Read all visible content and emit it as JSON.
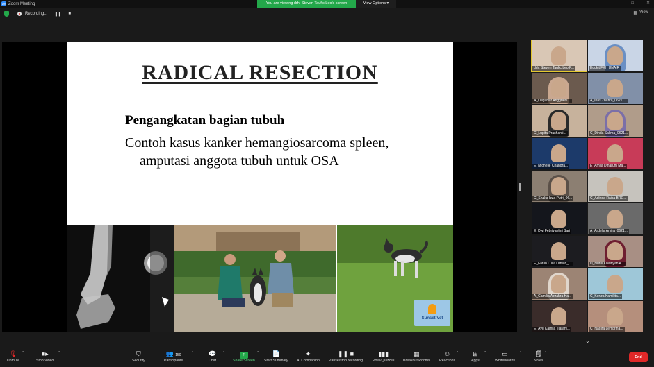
{
  "window": {
    "title": "Zoom Meeting",
    "app_icon": "zm"
  },
  "banner": {
    "viewing": "You are viewing drh. Steven Taufic Leo's screen",
    "view_options": "View Options"
  },
  "window_controls": {
    "minimize": "–",
    "maximize": "□",
    "close": "✕"
  },
  "status": {
    "recording_label": "Recording...",
    "pause": "❚❚",
    "stop": "■",
    "view": "View"
  },
  "slide": {
    "title": "RADICAL RESECTION",
    "subtitle": "Pengangkatan bagian tubuh",
    "line1": "Contoh kasus kanker hemangiosarcoma spleen,",
    "line2": "amputasi anggota tubuh untuk OSA",
    "logo_text": "Sunset Vet"
  },
  "participants": [
    {
      "name": "drh. Steven Taufic Leo P...",
      "color": "#d9c7b5",
      "active": true
    },
    {
      "name": "Edukit FKH UNAIR",
      "color": "#c9d5e6",
      "hijab": "#6a8fc4"
    },
    {
      "name": "A_Luigi Nur Anggraini...",
      "color": "#6b5a4e",
      "hijab": "#caa890"
    },
    {
      "name": "A_Inas Zhafira_06211...",
      "color": "#8190a8"
    },
    {
      "name": "C_Lupita Prashanti...",
      "color": "#c7b29c",
      "hijab": "#2a2a2a"
    },
    {
      "name": "C_Dinda Salima_0621...",
      "color": "#b09c8a",
      "hijab": "#7b6fa8"
    },
    {
      "name": "E_Michelle Chandra...",
      "color": "#1c3a6a"
    },
    {
      "name": "E_Amila Dinarum Ma...",
      "color": "#c83b58"
    },
    {
      "name": "C_Shaka Izza Putri_06...",
      "color": "#8c7f72",
      "hijab": "#5b5048"
    },
    {
      "name": "C_Adinda Raisa BRG...",
      "color": "#c6c3bd"
    },
    {
      "name": "E_Dwi Febriyantini Sari",
      "color": "#14161c"
    },
    {
      "name": "A_Ardelia Amira_0621...",
      "color": "#6a6a6a"
    },
    {
      "name": "E_Fatun Lulia Lutfiah_...",
      "color": "#1c1c20"
    },
    {
      "name": "D_Nurul Khairiyah A...",
      "color": "#a88f84",
      "hijab": "#6e1e30"
    },
    {
      "name": "A_Camilia Azzahra Ha...",
      "color": "#9c8474",
      "hijab": "#e0d6cc"
    },
    {
      "name": "C_Kenza Kamilita...",
      "color": "#9ec7d8"
    },
    {
      "name": "E_Ayu Kamila Tiarani...",
      "color": "#3a2c2a"
    },
    {
      "name": "C_Nadira Lembrina...",
      "color": "#b58f7c"
    }
  ],
  "toolbar": {
    "unmute": "Unmute",
    "stop_video": "Stop Video",
    "security": "Security",
    "participants": "Participants",
    "participant_count": "150",
    "chat": "Chat",
    "share_screen": "Share Screen",
    "start_summary": "Start Summary",
    "ai_companion": "AI Companion",
    "pause_recording": "Pause/stop recording",
    "polls": "Polls/Quizzes",
    "breakout": "Breakout Rooms",
    "reactions": "Reactions",
    "apps": "Apps",
    "whiteboards": "Whiteboards",
    "notes": "Notes",
    "end": "End"
  },
  "colors": {
    "banner": "#23a84a",
    "end": "#e02828",
    "active_speaker": "#e5c830"
  }
}
